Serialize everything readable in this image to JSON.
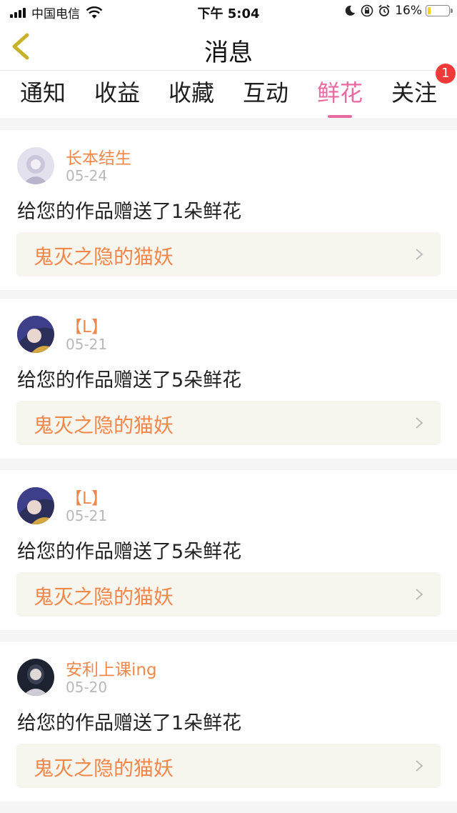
{
  "status_bar": {
    "carrier": "中国电信",
    "time": "下午 5:04",
    "battery_percent": "16%",
    "battery_level": 0.16,
    "battery_color": "#f7d21c"
  },
  "header": {
    "title": "消息",
    "back_icon": "chevron-left-icon",
    "back_icon_color": "#c9b227"
  },
  "tabs": [
    {
      "label": "通知",
      "active": false
    },
    {
      "label": "收益",
      "active": false
    },
    {
      "label": "收藏",
      "active": false
    },
    {
      "label": "互动",
      "active": false
    },
    {
      "label": "鲜花",
      "active": true
    },
    {
      "label": "关注",
      "active": false,
      "badge": "1"
    }
  ],
  "accent_color": "#e86aa0",
  "messages": [
    {
      "username": "长本结生",
      "date": "05-24",
      "text": "给您的作品赠送了1朵鲜花",
      "work_title": "鬼灭之隐的猫妖"
    },
    {
      "username": "【L】",
      "date": "05-21",
      "text": "给您的作品赠送了5朵鲜花",
      "work_title": "鬼灭之隐的猫妖"
    },
    {
      "username": "【L】",
      "date": "05-21",
      "text": "给您的作品赠送了5朵鲜花",
      "work_title": "鬼灭之隐的猫妖"
    },
    {
      "username": "安利上课ing",
      "date": "05-20",
      "text": "给您的作品赠送了1朵鲜花",
      "work_title": "鬼灭之隐的猫妖"
    }
  ]
}
